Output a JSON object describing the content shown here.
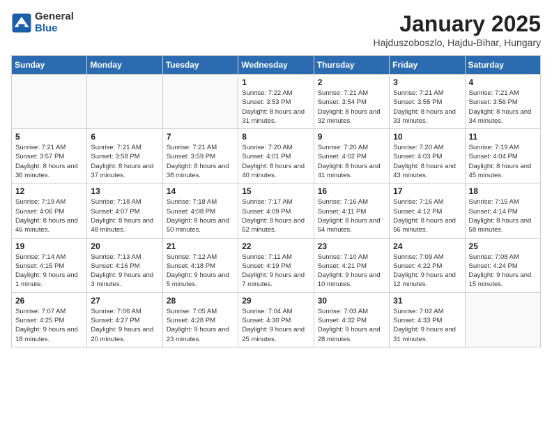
{
  "header": {
    "logo_general": "General",
    "logo_blue": "Blue",
    "title": "January 2025",
    "subtitle": "Hajduszoboszlo, Hajdu-Bihar, Hungary"
  },
  "weekdays": [
    "Sunday",
    "Monday",
    "Tuesday",
    "Wednesday",
    "Thursday",
    "Friday",
    "Saturday"
  ],
  "weeks": [
    [
      {
        "day": "",
        "sunrise": "",
        "sunset": "",
        "daylight": ""
      },
      {
        "day": "",
        "sunrise": "",
        "sunset": "",
        "daylight": ""
      },
      {
        "day": "",
        "sunrise": "",
        "sunset": "",
        "daylight": ""
      },
      {
        "day": "1",
        "sunrise": "Sunrise: 7:22 AM",
        "sunset": "Sunset: 3:53 PM",
        "daylight": "Daylight: 8 hours and 31 minutes."
      },
      {
        "day": "2",
        "sunrise": "Sunrise: 7:21 AM",
        "sunset": "Sunset: 3:54 PM",
        "daylight": "Daylight: 8 hours and 32 minutes."
      },
      {
        "day": "3",
        "sunrise": "Sunrise: 7:21 AM",
        "sunset": "Sunset: 3:55 PM",
        "daylight": "Daylight: 8 hours and 33 minutes."
      },
      {
        "day": "4",
        "sunrise": "Sunrise: 7:21 AM",
        "sunset": "Sunset: 3:56 PM",
        "daylight": "Daylight: 8 hours and 34 minutes."
      }
    ],
    [
      {
        "day": "5",
        "sunrise": "Sunrise: 7:21 AM",
        "sunset": "Sunset: 3:57 PM",
        "daylight": "Daylight: 8 hours and 36 minutes."
      },
      {
        "day": "6",
        "sunrise": "Sunrise: 7:21 AM",
        "sunset": "Sunset: 3:58 PM",
        "daylight": "Daylight: 8 hours and 37 minutes."
      },
      {
        "day": "7",
        "sunrise": "Sunrise: 7:21 AM",
        "sunset": "Sunset: 3:59 PM",
        "daylight": "Daylight: 8 hours and 38 minutes."
      },
      {
        "day": "8",
        "sunrise": "Sunrise: 7:20 AM",
        "sunset": "Sunset: 4:01 PM",
        "daylight": "Daylight: 8 hours and 40 minutes."
      },
      {
        "day": "9",
        "sunrise": "Sunrise: 7:20 AM",
        "sunset": "Sunset: 4:02 PM",
        "daylight": "Daylight: 8 hours and 41 minutes."
      },
      {
        "day": "10",
        "sunrise": "Sunrise: 7:20 AM",
        "sunset": "Sunset: 4:03 PM",
        "daylight": "Daylight: 8 hours and 43 minutes."
      },
      {
        "day": "11",
        "sunrise": "Sunrise: 7:19 AM",
        "sunset": "Sunset: 4:04 PM",
        "daylight": "Daylight: 8 hours and 45 minutes."
      }
    ],
    [
      {
        "day": "12",
        "sunrise": "Sunrise: 7:19 AM",
        "sunset": "Sunset: 4:06 PM",
        "daylight": "Daylight: 8 hours and 46 minutes."
      },
      {
        "day": "13",
        "sunrise": "Sunrise: 7:18 AM",
        "sunset": "Sunset: 4:07 PM",
        "daylight": "Daylight: 8 hours and 48 minutes."
      },
      {
        "day": "14",
        "sunrise": "Sunrise: 7:18 AM",
        "sunset": "Sunset: 4:08 PM",
        "daylight": "Daylight: 8 hours and 50 minutes."
      },
      {
        "day": "15",
        "sunrise": "Sunrise: 7:17 AM",
        "sunset": "Sunset: 4:09 PM",
        "daylight": "Daylight: 8 hours and 52 minutes."
      },
      {
        "day": "16",
        "sunrise": "Sunrise: 7:16 AM",
        "sunset": "Sunset: 4:11 PM",
        "daylight": "Daylight: 8 hours and 54 minutes."
      },
      {
        "day": "17",
        "sunrise": "Sunrise: 7:16 AM",
        "sunset": "Sunset: 4:12 PM",
        "daylight": "Daylight: 8 hours and 56 minutes."
      },
      {
        "day": "18",
        "sunrise": "Sunrise: 7:15 AM",
        "sunset": "Sunset: 4:14 PM",
        "daylight": "Daylight: 8 hours and 58 minutes."
      }
    ],
    [
      {
        "day": "19",
        "sunrise": "Sunrise: 7:14 AM",
        "sunset": "Sunset: 4:15 PM",
        "daylight": "Daylight: 9 hours and 1 minute."
      },
      {
        "day": "20",
        "sunrise": "Sunrise: 7:13 AM",
        "sunset": "Sunset: 4:16 PM",
        "daylight": "Daylight: 9 hours and 3 minutes."
      },
      {
        "day": "21",
        "sunrise": "Sunrise: 7:12 AM",
        "sunset": "Sunset: 4:18 PM",
        "daylight": "Daylight: 9 hours and 5 minutes."
      },
      {
        "day": "22",
        "sunrise": "Sunrise: 7:11 AM",
        "sunset": "Sunset: 4:19 PM",
        "daylight": "Daylight: 9 hours and 7 minutes."
      },
      {
        "day": "23",
        "sunrise": "Sunrise: 7:10 AM",
        "sunset": "Sunset: 4:21 PM",
        "daylight": "Daylight: 9 hours and 10 minutes."
      },
      {
        "day": "24",
        "sunrise": "Sunrise: 7:09 AM",
        "sunset": "Sunset: 4:22 PM",
        "daylight": "Daylight: 9 hours and 12 minutes."
      },
      {
        "day": "25",
        "sunrise": "Sunrise: 7:08 AM",
        "sunset": "Sunset: 4:24 PM",
        "daylight": "Daylight: 9 hours and 15 minutes."
      }
    ],
    [
      {
        "day": "26",
        "sunrise": "Sunrise: 7:07 AM",
        "sunset": "Sunset: 4:25 PM",
        "daylight": "Daylight: 9 hours and 18 minutes."
      },
      {
        "day": "27",
        "sunrise": "Sunrise: 7:06 AM",
        "sunset": "Sunset: 4:27 PM",
        "daylight": "Daylight: 9 hours and 20 minutes."
      },
      {
        "day": "28",
        "sunrise": "Sunrise: 7:05 AM",
        "sunset": "Sunset: 4:28 PM",
        "daylight": "Daylight: 9 hours and 23 minutes."
      },
      {
        "day": "29",
        "sunrise": "Sunrise: 7:04 AM",
        "sunset": "Sunset: 4:30 PM",
        "daylight": "Daylight: 9 hours and 25 minutes."
      },
      {
        "day": "30",
        "sunrise": "Sunrise: 7:03 AM",
        "sunset": "Sunset: 4:32 PM",
        "daylight": "Daylight: 9 hours and 28 minutes."
      },
      {
        "day": "31",
        "sunrise": "Sunrise: 7:02 AM",
        "sunset": "Sunset: 4:33 PM",
        "daylight": "Daylight: 9 hours and 31 minutes."
      },
      {
        "day": "",
        "sunrise": "",
        "sunset": "",
        "daylight": ""
      }
    ]
  ]
}
